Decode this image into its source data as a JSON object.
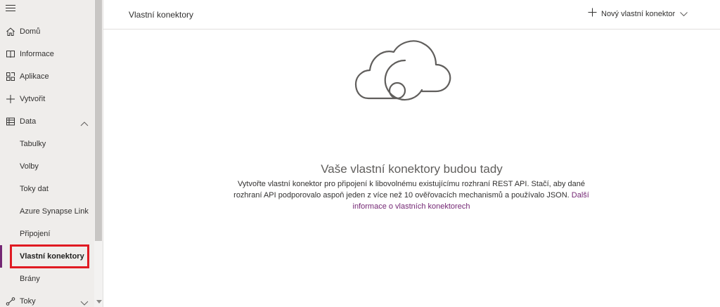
{
  "sidebar": {
    "items": [
      {
        "label": "Domů",
        "icon": "home-icon"
      },
      {
        "label": "Informace",
        "icon": "book-icon"
      },
      {
        "label": "Aplikace",
        "icon": "apps-icon"
      },
      {
        "label": "Vytvořit",
        "icon": "plus-icon"
      },
      {
        "label": "Data",
        "icon": "table-icon",
        "expanded": true
      }
    ],
    "sub_items": [
      {
        "label": "Tabulky"
      },
      {
        "label": "Volby"
      },
      {
        "label": "Toky dat"
      },
      {
        "label": "Azure Synapse Link"
      },
      {
        "label": "Připojení"
      },
      {
        "label": "Vlastní konektory",
        "active": true
      },
      {
        "label": "Brány"
      }
    ],
    "bottom_item": {
      "label": "Toky",
      "icon": "flow-icon"
    }
  },
  "header": {
    "title": "Vlastní konektory",
    "new_connector_label": "Nový vlastní konektor"
  },
  "empty_state": {
    "icon": "cloud-icon",
    "title": "Vaše vlastní konektory budou tady",
    "text": "Vytvořte vlastní konektor pro připojení k libovolnému existujícímu rozhraní REST API. Stačí, aby dané rozhraní API podporovalo aspoň jeden z více než 10 ověřovacích mechanismů a používalo JSON.",
    "link": "Další informace o vlastních konektorech"
  },
  "colors": {
    "accent": "#742774",
    "highlight": "#e01a22",
    "sidebar_bg": "#efedeb"
  }
}
